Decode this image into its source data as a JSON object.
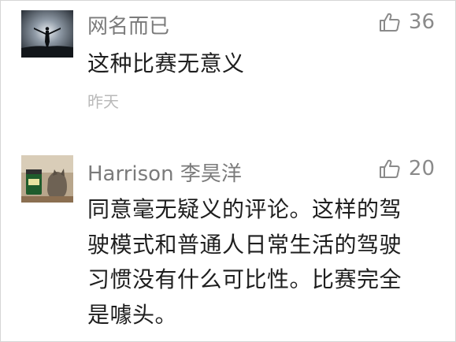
{
  "comments": [
    {
      "username": "网名而已",
      "likes": "36",
      "lines": [
        "这种比赛无意义"
      ],
      "time": "昨天"
    },
    {
      "username": "Harrison 李昊洋",
      "likes": "20",
      "lines": [
        "同意毫无疑义的评论。这样的驾",
        "驶模式和普通人日常生活的驾驶",
        "习惯没有什么可比性。比赛完全",
        "是噱头。"
      ]
    }
  ]
}
